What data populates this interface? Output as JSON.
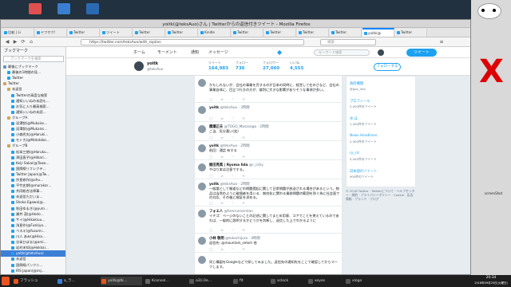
{
  "window": {
    "title": "yoitk(@teksAuo)さん | Twitterからの返信付きツイート - Mozilla Firefox",
    "url": "https://twitter.com/teksAuo/with_replies",
    "search_placeholder": "検索"
  },
  "tabs": [
    {
      "label": "比較 | Li"
    },
    {
      "label": "ヤフオク!"
    },
    {
      "label": "Twitter"
    },
    {
      "label": "ツイート"
    },
    {
      "label": "Twitter"
    },
    {
      "label": "Twitter"
    },
    {
      "label": "Kindle"
    },
    {
      "label": "Twitter"
    },
    {
      "label": "Twitter"
    },
    {
      "label": "Twitter"
    },
    {
      "label": "Twitter"
    },
    {
      "label": "yoitk(@"
    },
    {
      "label": "Twitter"
    }
  ],
  "sidebar": {
    "title": "ブックマーク",
    "search_placeholder": "ブックマークを検索",
    "items": [
      {
        "label": "最後にブックマーク",
        "indent": 0,
        "color": "#6a90c9"
      },
      {
        "label": "最後の1時間の見…",
        "indent": 1,
        "color": "#1da1f2"
      },
      {
        "label": "Twitter",
        "indent": 1,
        "color": "#1da1f2"
      },
      {
        "label": "Twitter",
        "indent": 0,
        "color": "#c9a75a"
      },
      {
        "label": "未返信",
        "indent": 1,
        "color": "#c9a75a"
      },
      {
        "label": "Twitterの高度な検索",
        "indent": 2,
        "color": "#1da1f2"
      },
      {
        "label": "通知いいねの未読も…",
        "indent": 2,
        "color": "#1da1f2"
      },
      {
        "label": "お気に入り最高検索…",
        "indent": 2,
        "color": "#1da1f2"
      },
      {
        "label": "通知いいねの未読…",
        "indent": 2,
        "color": "#1da1f2"
      },
      {
        "label": "グループA",
        "indent": 1,
        "color": "#c9a75a"
      },
      {
        "label": "深澤諒(@Mukaiss…",
        "indent": 2,
        "color": "#1da1f2"
      },
      {
        "label": "深澤諒(@Mukaiss…",
        "indent": 2,
        "color": "#1da1f2"
      },
      {
        "label": "小森秀丸(@Haruki…",
        "indent": 2,
        "color": "#1da1f2"
      },
      {
        "label": "モトカ(@Mototake…",
        "indent": 2,
        "color": "#1da1f2"
      },
      {
        "label": "グループB",
        "indent": 1,
        "color": "#c9a75a"
      },
      {
        "label": "松本三徳(@Haruku…",
        "indent": 2,
        "color": "#1da1f2"
      },
      {
        "label": "津田直子(@Hikari…",
        "indent": 2,
        "color": "#1da1f2"
      },
      {
        "label": "Keiji Sakai(@Tawa…",
        "indent": 2,
        "color": "#1da1f2"
      },
      {
        "label": "国際線リフレクテ…",
        "indent": 2,
        "color": "#1da1f2"
      },
      {
        "label": "Twitter Japan(@Tw…",
        "indent": 2,
        "color": "#1da1f2"
      },
      {
        "label": "宗島修作(@shu…",
        "indent": 2,
        "color": "#1da1f2"
      },
      {
        "label": "平竹史朗(@murakar…",
        "indent": 2,
        "color": "#1da1f2"
      },
      {
        "label": "共同総合法律事…",
        "indent": 2,
        "color": "#1da1f2"
      },
      {
        "label": "未返信ただいま…",
        "indent": 2,
        "color": "#1da1f2"
      },
      {
        "label": "Shoko Egawa(@…",
        "indent": 2,
        "color": "#1da1f2"
      },
      {
        "label": "秋田ゆまき(@yum…",
        "indent": 2,
        "color": "#1da1f2"
      },
      {
        "label": "瀬井 茂(@Hodo…",
        "indent": 2,
        "color": "#1da1f2"
      },
      {
        "label": "サイ(@Hikakiuu…",
        "indent": 2,
        "color": "#1da1f2"
      },
      {
        "label": "浅島作(@Fuskiyo…",
        "indent": 2,
        "color": "#1da1f2"
      },
      {
        "label": "ペスキ(@fuzumi…",
        "indent": 2,
        "color": "#1da1f2"
      },
      {
        "label": "川人 あみ(@Hisa…",
        "indent": 2,
        "color": "#1da1f2"
      },
      {
        "label": "谷本ひぼる(@ami…",
        "indent": 2,
        "color": "#1da1f2"
      },
      {
        "label": "岩村未知(@Hokkai…",
        "indent": 2,
        "color": "#1da1f2"
      },
      {
        "label": "yoitk(@teksAuo)",
        "indent": 2,
        "color": "#1da1f2",
        "selected": true
      },
      {
        "label": "未返信",
        "indent": 2,
        "color": "#1da1f2"
      },
      {
        "label": "国際線パンクニ…",
        "indent": 2,
        "color": "#1da1f2"
      },
      {
        "label": "IRS Japan(@irsj…",
        "indent": 2,
        "color": "#1da1f2"
      }
    ]
  },
  "twitter_nav": {
    "home": "ホーム",
    "moments": "モーメント",
    "notifications": "通知",
    "messages": "メッセージ",
    "search_placeholder": "キーワード検索",
    "tweet_button": "ツイート"
  },
  "profile": {
    "name": "yoitk",
    "handle": "@teksAuo",
    "stats": [
      {
        "label": "ツイート",
        "value": "164,983"
      },
      {
        "label": "フォロー",
        "value": "736"
      },
      {
        "label": "フォロワー",
        "value": "27,060"
      },
      {
        "label": "いいね",
        "value": "4,555"
      }
    ],
    "follow_button": "フォローする"
  },
  "tweets": [
    {
      "name": "",
      "handle": "",
      "text": "かもしれないが、会社の事業を売するのが日本の同時に、経営して在のさなど、会社の事業自体に、目立つ行方の方が、裁判に大きな影響がありそうな事項が多い。"
    },
    {
      "name": "yoitk",
      "handle": "@teksAuo · 3時間",
      "text": ""
    },
    {
      "name": "廣瀬正夫",
      "handle": "@TOGO_Masasaga · 2時間",
      "text": "ご当、気分悪い(笑)"
    },
    {
      "name": "yoitk",
      "handle": "@teksAuo · 2時間",
      "text": "前回：通話 有する"
    },
    {
      "name": "飯田亮真 | Ryoma Iida",
      "handle": "@r_iiiiiiy",
      "text": "やはり本は注意でする。"
    },
    {
      "name": "yoitk",
      "handle": "@teksAuo · 2時間",
      "text": "一般論として報道などの問題提起に関して日常問題が放送される場合があるという。物品は当然のように破損者を用いる、無効化に関わる業務問題の範囲を防ぐ為に社会面での対応、その後に検証を求める。"
    },
    {
      "name": "フォエ人",
      "handle": "@forerunnerstan",
      "text": "イチゴ：ページのないことの記述に関してまとめ用意、コアでことを覚えているのであれば、一般的に説明するかどうかを判断し、返信した上でわかるように"
    },
    {
      "name": "小林 敬明",
      "handle": "@tokachijuro · 4時間",
      "text": "返信先: @mountain_select 他"
    },
    {
      "name": "",
      "handle": "",
      "text": "同じ構図をGoogleなどで探してみました。返信先の通知先をここで確認してからマークします。"
    }
  ],
  "right_column": {
    "items": [
      {
        "name": "政府機関",
        "handle": "@gov_info"
      },
      {
        "name": "プロフィール",
        "handle": "2,000件のツイート"
      },
      {
        "name": "ゆ ほ",
        "handle": "1,000件のツイート"
      },
      {
        "name": "News Headlines",
        "handle": "2,500件のツイート"
      },
      {
        "name": "ry_cd",
        "handle": "5,000件のツイート"
      },
      {
        "name": "日本語のツイート",
        "handle": "900件のツイート"
      }
    ],
    "footer": "© 2018 Twitter · Twitterについて · ヘルプセンター · 規約 · プライバシーポリシー · Cookie · 広告情報 · ブランド · ブログ"
  },
  "taskbar": {
    "tasks": [
      {
        "label": "フラッシュ",
        "color": "#e95420"
      },
      {
        "label": "a_ラ…",
        "color": "#3d7fd6"
      },
      {
        "label": "yoitk@tk…",
        "color": "#e95420"
      },
      {
        "label": "Kconsol…",
        "color": "#666"
      },
      {
        "label": "a3(i.0e…",
        "color": "#555"
      },
      {
        "label": "fit",
        "color": "#555"
      },
      {
        "label": "xclock",
        "color": "#555"
      },
      {
        "label": "xeyes",
        "color": "#555"
      },
      {
        "label": "xlogo",
        "color": "#555"
      }
    ],
    "time": "20:34",
    "date": "2018年09月25日(火曜日)"
  },
  "right_panel": {
    "screenshot_label": "screenShot"
  }
}
